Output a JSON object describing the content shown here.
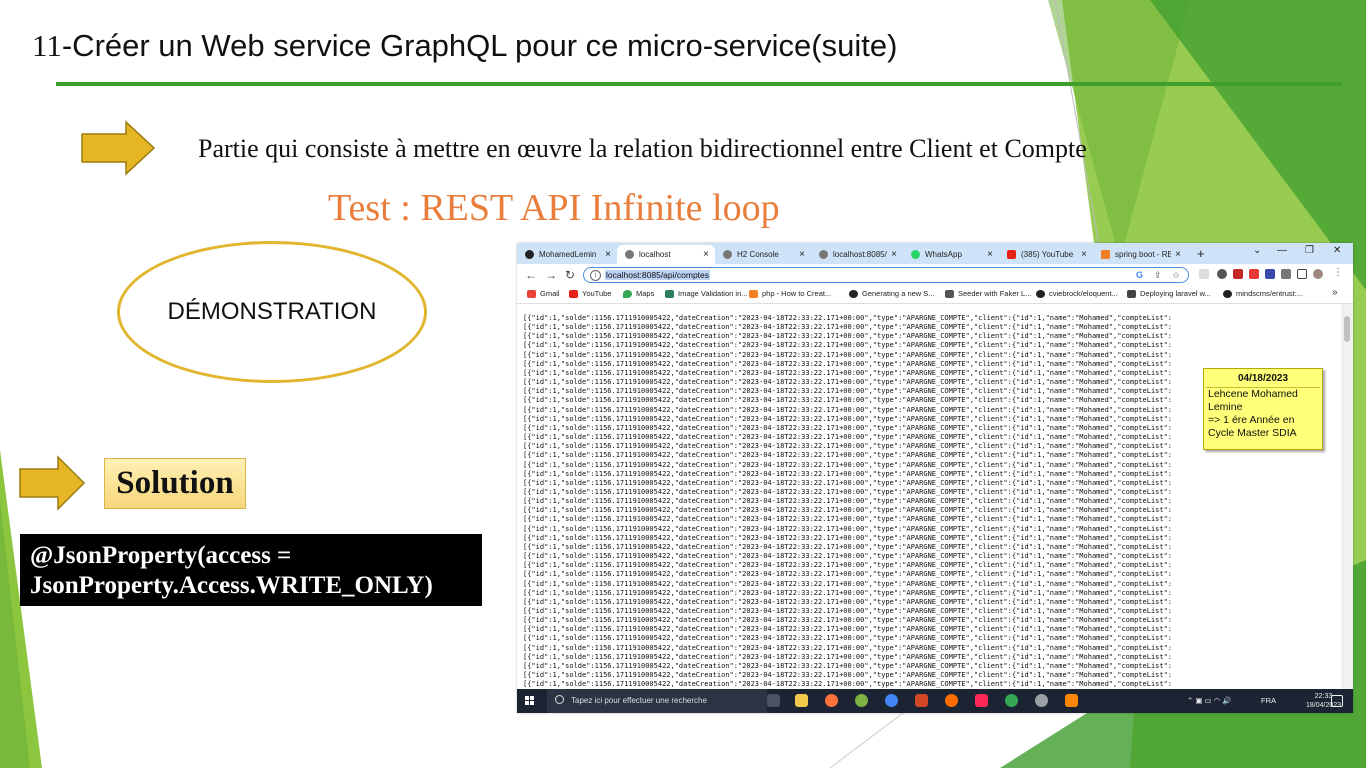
{
  "slide": {
    "title_number": "11",
    "title_text": "-Créer un Web service GraphQL pour ce micro-service(suite)",
    "subtitle": "Partie qui consiste à mettre en œuvre la relation bidirectionnel entre Client et Compte",
    "test_heading": "Test : REST API Infinite loop",
    "demo_label": "DÉMONSTRATION",
    "solution_label": "Solution",
    "code_line1": "@JsonProperty(access =",
    "code_line2": "JsonProperty.Access.WRITE_ONLY)",
    "colors": {
      "title_rule": "#3f9e2e",
      "heading": "#e97d3c",
      "arrow": "#e6b624",
      "ellipse": "#e1b52e",
      "green_accent": "#8cc63e"
    }
  },
  "browser": {
    "tabs": [
      {
        "label": "MohamedLemin",
        "icon": "github-icon"
      },
      {
        "label": "localhost",
        "icon": "globe-icon",
        "active": true
      },
      {
        "label": "H2 Console",
        "icon": "globe-icon"
      },
      {
        "label": "localhost:8085/g",
        "icon": "globe-icon"
      },
      {
        "label": "WhatsApp",
        "icon": "whatsapp-icon"
      },
      {
        "label": "(385) YouTube",
        "icon": "youtube-icon"
      },
      {
        "label": "spring boot - RE",
        "icon": "stackoverflow-icon"
      }
    ],
    "new_tab": "+",
    "url": "localhost:8085/api/comptes",
    "bookmarks": [
      {
        "label": "Gmail",
        "icon": "gmail-icon"
      },
      {
        "label": "YouTube",
        "icon": "youtube-icon"
      },
      {
        "label": "Maps",
        "icon": "maps-icon"
      },
      {
        "label": "Image Validation in...",
        "icon": "bookmark-icon"
      },
      {
        "label": "php - How to Creat...",
        "icon": "stackoverflow-icon"
      },
      {
        "label": "Generating a new S...",
        "icon": "github-icon"
      },
      {
        "label": "Seeder with Faker L...",
        "icon": "laravel-icon"
      },
      {
        "label": "cviebrock/eloquent...",
        "icon": "github-icon"
      },
      {
        "label": "Deploying laravel w...",
        "icon": "deploy-icon"
      },
      {
        "label": "mindscms/entrust:...",
        "icon": "github-icon"
      }
    ],
    "bookmarks_more": "»",
    "json_line": "[{\"id\":1,\"solde\":1156.1711910005422,\"dateCreation\":\"2023-04-18T22:33:22.171+00:00\",\"type\":\"APARGNE_COMPTE\",\"client\":{\"id\":1,\"name\":\"Mohamed\",\"compteList\":",
    "json_line_count": 41
  },
  "sticky_note": {
    "date": "04/18/2023",
    "line1": "Lehcene Mohamed",
    "line2": "Lemine",
    "line3": "=> 1 ére Année en",
    "line4": "Cycle Master SDIA"
  },
  "taskbar": {
    "search_placeholder": "Tapez ici pour effectuer une recherche",
    "language": "FRA",
    "time": "22:33",
    "date": "18/04/2023"
  }
}
